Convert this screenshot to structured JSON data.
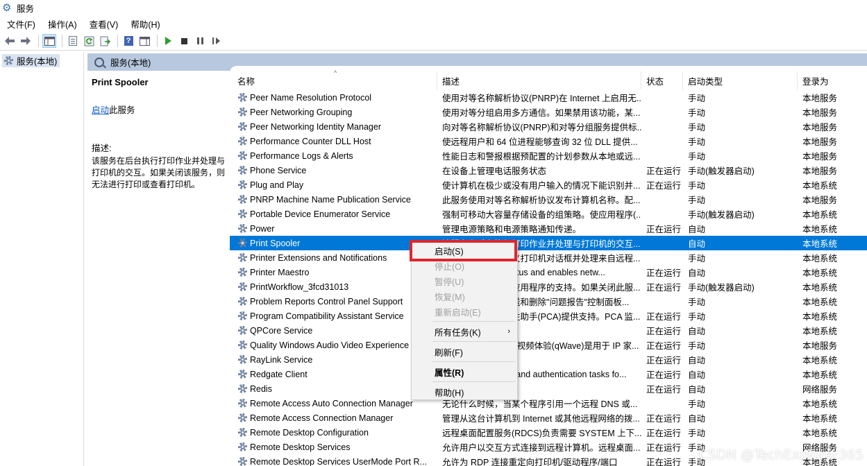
{
  "window": {
    "title": "服务"
  },
  "menu": [
    "文件(F)",
    "操作(A)",
    "查看(V)",
    "帮助(H)"
  ],
  "tree": {
    "root_label": "服务(本地)"
  },
  "pane": {
    "header": "服务(本地)"
  },
  "detail": {
    "service_name": "Print Spooler",
    "start_link": "启动",
    "start_suffix": "此服务",
    "desc_label": "描述:",
    "desc_text": "该服务在后台执行打印作业并处理与打印机的交互。如果关闭该服务，则无法进行打印或查看打印机。"
  },
  "columns": {
    "name": "名称",
    "desc": "描述",
    "status": "状态",
    "start": "启动类型",
    "logon": "登录为"
  },
  "rows": [
    {
      "name": "Peer Name Resolution Protocol",
      "desc": "使用对等名称解析协议(PNRP)在 Internet 上启用无...",
      "status": "",
      "start": "手动",
      "logon": "本地服务"
    },
    {
      "name": "Peer Networking Grouping",
      "desc": "使用对等分组启用多方通信。如果禁用该功能，某...",
      "status": "",
      "start": "手动",
      "logon": "本地服务"
    },
    {
      "name": "Peer Networking Identity Manager",
      "desc": "向对等名称解析协议(PNRP)和对等分组服务提供标...",
      "status": "",
      "start": "手动",
      "logon": "本地服务"
    },
    {
      "name": "Performance Counter DLL Host",
      "desc": "使远程用户和 64 位进程能够查询 32 位 DLL 提供...",
      "status": "",
      "start": "手动",
      "logon": "本地服务"
    },
    {
      "name": "Performance Logs & Alerts",
      "desc": "性能日志和警报根据预配置的计划参数从本地或远...",
      "status": "",
      "start": "手动",
      "logon": "本地服务"
    },
    {
      "name": "Phone Service",
      "desc": "在设备上管理电话服务状态",
      "status": "正在运行",
      "start": "手动(触发器启动)",
      "logon": "本地服务"
    },
    {
      "name": "Plug and Play",
      "desc": "使计算机在极少或没有用户输入的情况下能识别并...",
      "status": "正在运行",
      "start": "手动",
      "logon": "本地系统"
    },
    {
      "name": "PNRP Machine Name Publication Service",
      "desc": "此服务使用对等名称解析协议发布计算机名称。配...",
      "status": "",
      "start": "手动",
      "logon": "本地服务"
    },
    {
      "name": "Portable Device Enumerator Service",
      "desc": "强制可移动大容量存储设备的组策略。使应用程序(...",
      "status": "",
      "start": "手动(触发器启动)",
      "logon": "本地系统"
    },
    {
      "name": "Power",
      "desc": "管理电源策略和电源策略通知传递。",
      "status": "正在运行",
      "start": "自动",
      "logon": "本地系统"
    },
    {
      "name": "Print Spooler",
      "desc": "该服务在后台执行打印作业并处理与打印机的交互...",
      "status": "",
      "start": "自动",
      "logon": "本地系统",
      "selected": true
    },
    {
      "name": "Printer Extensions and Notifications",
      "desc": "此服务可打开自定义打印机对话框并处理来自远程...",
      "status": "",
      "start": "手动",
      "logon": "本地系统"
    },
    {
      "name": "Printer Maestro",
      "desc": "Monitors printer status and enables netw...",
      "status": "正在运行",
      "start": "自动",
      "logon": "本地系统"
    },
    {
      "name": "PrintWorkflow_3fcd31013",
      "desc": "提供对打印工作流应用程序的支持。如果关闭此服...",
      "status": "正在运行",
      "start": "手动(触发器启动)",
      "logon": "本地系统"
    },
    {
      "name": "Problem Reports Control Panel Support",
      "desc": "此服务为查看、发送和删除\"问题报告\"控制面板...",
      "status": "",
      "start": "手动",
      "logon": "本地系统"
    },
    {
      "name": "Program Compatibility Assistant Service",
      "desc": "此服务为程序兼容性助手(PCA)提供支持。PCA 监...",
      "status": "正在运行",
      "start": "手动",
      "logon": "本地系统"
    },
    {
      "name": "QPCore Service",
      "desc": "腾讯基础组件服务",
      "status": "正在运行",
      "start": "自动",
      "logon": "本地系统"
    },
    {
      "name": "Quality Windows Audio Video Experience",
      "desc": "优质 Windows 音频视频体验(qWave)是用于 IP 家...",
      "status": "正在运行",
      "start": "手动",
      "logon": "本地服务"
    },
    {
      "name": "RayLink Service",
      "desc": "",
      "status": "正在运行",
      "start": "自动",
      "logon": "本地系统"
    },
    {
      "name": "Redgate Client",
      "desc": "Performs licensing and authentication tasks fo...",
      "status": "正在运行",
      "start": "自动",
      "logon": "本地系统"
    },
    {
      "name": "Redis",
      "desc": "",
      "status": "正在运行",
      "start": "自动",
      "logon": "网络服务"
    },
    {
      "name": "Remote Access Auto Connection Manager",
      "desc": "无论什么时候，当某个程序引用一个远程 DNS 或...",
      "status": "",
      "start": "手动",
      "logon": "本地系统"
    },
    {
      "name": "Remote Access Connection Manager",
      "desc": "管理从这台计算机到 Internet 或其他远程网络的拨...",
      "status": "正在运行",
      "start": "自动",
      "logon": "本地系统"
    },
    {
      "name": "Remote Desktop Configuration",
      "desc": "远程桌面配置服务(RDCS)负责需要 SYSTEM 上下...",
      "status": "正在运行",
      "start": "手动",
      "logon": "本地系统"
    },
    {
      "name": "Remote Desktop Services",
      "desc": "允许用户以交互方式连接到远程计算机。远程桌面...",
      "status": "正在运行",
      "start": "手动",
      "logon": "网络服务"
    },
    {
      "name": "Remote Desktop Services UserMode Port R...",
      "desc": "允许为 RDP 连接重定向打印机/驱动程序/端口",
      "status": "正在运行",
      "start": "手动",
      "logon": "本地系统"
    }
  ],
  "context_menu": {
    "start": "启动(S)",
    "stop": "停止(O)",
    "pause": "暂停(U)",
    "resume": "恢复(M)",
    "restart": "重新启动(E)",
    "all_tasks": "所有任务(K)",
    "refresh": "刷新(F)",
    "properties": "属性(R)",
    "help": "帮助(H)"
  },
  "colors": {
    "selection": "#0078d7",
    "highlight_box": "#e0252b",
    "pane_bg": "#b7c8df"
  },
  "watermark": "CSDN @TechExplorer365"
}
